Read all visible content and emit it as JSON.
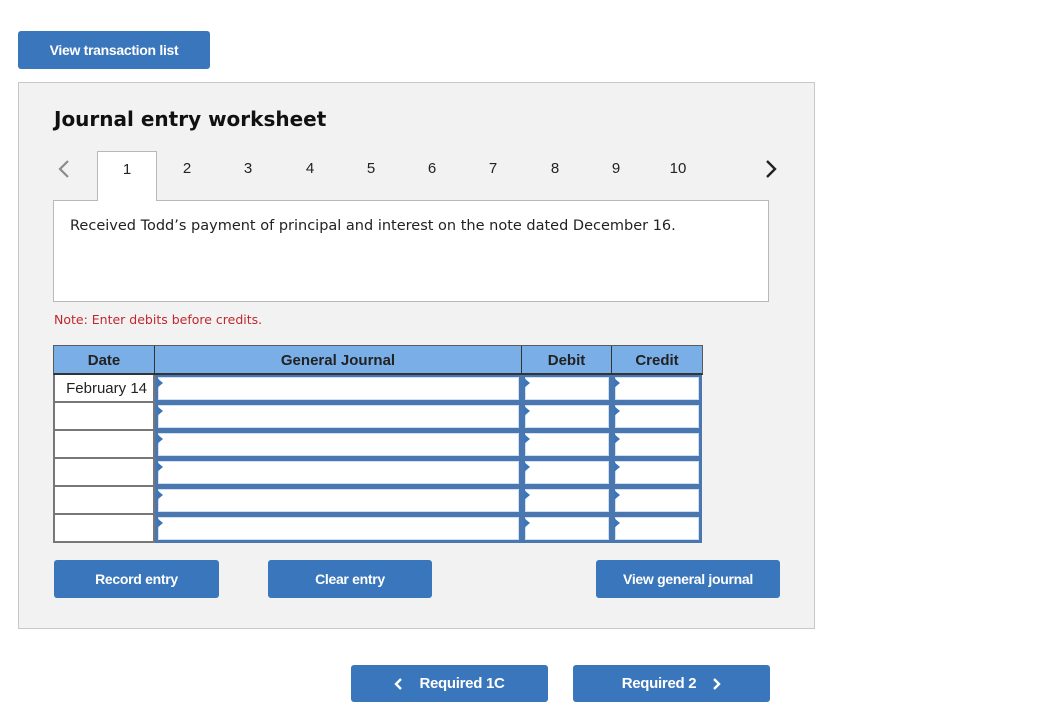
{
  "top_button": {
    "label": "View transaction list"
  },
  "worksheet": {
    "title": "Journal entry worksheet",
    "tabs": [
      {
        "label": "1",
        "active": true
      },
      {
        "label": "2"
      },
      {
        "label": "3"
      },
      {
        "label": "4"
      },
      {
        "label": "5"
      },
      {
        "label": "6"
      },
      {
        "label": "7"
      },
      {
        "label": "8"
      },
      {
        "label": "9"
      },
      {
        "label": "10"
      }
    ],
    "prev_icon": "chevron-left-icon",
    "next_icon": "chevron-right-icon",
    "description": "Received Todd’s payment of principal and interest on the note dated December 16.",
    "note": "Note: Enter debits before credits.",
    "table": {
      "headers": {
        "date": "Date",
        "general_journal": "General Journal",
        "debit": "Debit",
        "credit": "Credit"
      },
      "rows": [
        {
          "date": "February 14",
          "account": "",
          "debit": "",
          "credit": ""
        },
        {
          "date": "",
          "account": "",
          "debit": "",
          "credit": ""
        },
        {
          "date": "",
          "account": "",
          "debit": "",
          "credit": ""
        },
        {
          "date": "",
          "account": "",
          "debit": "",
          "credit": ""
        },
        {
          "date": "",
          "account": "",
          "debit": "",
          "credit": ""
        },
        {
          "date": "",
          "account": "",
          "debit": "",
          "credit": ""
        }
      ]
    },
    "buttons": {
      "record": "Record entry",
      "clear": "Clear entry",
      "view_general_journal": "View general journal"
    }
  },
  "nav": {
    "prev_label": "Required 1C",
    "next_label": "Required 2"
  },
  "colors": {
    "button_blue": "#3a76bb",
    "header_blue": "#7aaee6",
    "note_red": "#c0282d",
    "panel_gray": "#f2f2f2"
  }
}
